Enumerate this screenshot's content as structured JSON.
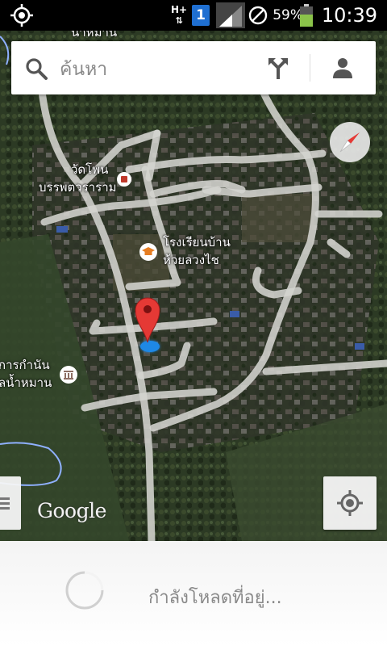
{
  "status_bar": {
    "network_type": "H+",
    "notification_count": "1",
    "battery_percent": "59%",
    "time": "10:39",
    "icons": [
      "gps-icon",
      "data-arrows-icon",
      "sim-badge-icon",
      "signal-icon",
      "do-not-disturb-icon",
      "battery-icon"
    ]
  },
  "search": {
    "placeholder": "ค้นหา",
    "icons": [
      "search-icon",
      "directions-icon",
      "account-icon"
    ]
  },
  "map": {
    "labels": {
      "temple_line1": "วัดโพน",
      "temple_line2": "บรรพตวราราม",
      "school_line1": "โรงเรียนบ้าน",
      "school_line2": "ห้วยลวงไช",
      "office_line1": "การกำนัน",
      "office_line2": "ลน้ำหมาน",
      "top_cut": "น้ำหมาน"
    },
    "marker_color": "#d32f2f",
    "location_dot_color": "#1e88e5",
    "attribution": "Google"
  },
  "loading": {
    "text": "กำลังโหลดที่อยู่..."
  }
}
